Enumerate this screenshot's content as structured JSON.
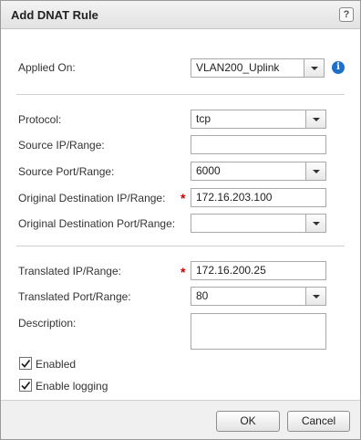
{
  "dialog": {
    "title": "Add DNAT Rule",
    "help_icon": "?"
  },
  "applied_on": {
    "label": "Applied On:",
    "value": "VLAN200_Uplink",
    "info_icon": "i"
  },
  "protocol": {
    "label": "Protocol:",
    "value": "tcp"
  },
  "source_ip": {
    "label": "Source IP/Range:",
    "value": ""
  },
  "source_port": {
    "label": "Source Port/Range:",
    "value": "6000"
  },
  "orig_dest_ip": {
    "label": "Original Destination IP/Range:",
    "value": "172.16.203.100",
    "required": "*"
  },
  "orig_dest_port": {
    "label": "Original Destination Port/Range:",
    "value": ""
  },
  "translated_ip": {
    "label": "Translated IP/Range:",
    "value": "172.16.200.25",
    "required": "*"
  },
  "translated_port": {
    "label": "Translated Port/Range:",
    "value": "80"
  },
  "description": {
    "label": "Description:",
    "value": ""
  },
  "enabled": {
    "label": "Enabled",
    "checked": true
  },
  "enable_logging": {
    "label": "Enable logging",
    "checked": true
  },
  "buttons": {
    "ok": "OK",
    "cancel": "Cancel"
  },
  "colors": {
    "required": "#cc0000",
    "info": "#1e6fc8"
  }
}
